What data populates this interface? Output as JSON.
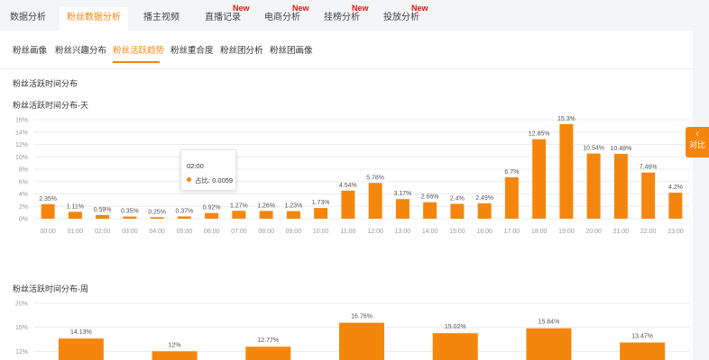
{
  "top_tabs": [
    {
      "label": "数据分析",
      "new": ""
    },
    {
      "label": "粉丝数据分析",
      "new": ""
    },
    {
      "label": "播主视频",
      "new": ""
    },
    {
      "label": "直播记录",
      "new": "New"
    },
    {
      "label": "电商分析",
      "new": "New"
    },
    {
      "label": "挂榜分析",
      "new": "New"
    },
    {
      "label": "投放分析",
      "new": "New"
    }
  ],
  "sub_tabs": [
    "粉丝画像",
    "粉丝兴趣分布",
    "粉丝活跃趋势",
    "粉丝重合度",
    "粉丝团分析",
    "粉丝团画像"
  ],
  "section_title": "粉丝活跃时间分布",
  "compare_button": {
    "chevron": "‹",
    "label": "对比"
  },
  "tooltip": {
    "time": "02:00",
    "label": "占比: 0.0059"
  },
  "colors": {
    "accent": "#f5860d",
    "bar": "#f5860d",
    "grid": "#ececec"
  },
  "chart_data": [
    {
      "type": "bar",
      "title": "粉丝活跃时间分布-天",
      "categories": [
        "00:00",
        "01:00",
        "02:00",
        "03:00",
        "04:00",
        "05:00",
        "06:00",
        "07:00",
        "08:00",
        "09:00",
        "10:00",
        "11:00",
        "12:00",
        "13:00",
        "14:00",
        "15:00",
        "16:00",
        "17:00",
        "18:00",
        "19:00",
        "20:00",
        "21:00",
        "22:00",
        "23:00"
      ],
      "values": [
        2.35,
        1.11,
        0.59,
        0.35,
        0.25,
        0.37,
        0.92,
        1.27,
        1.26,
        1.23,
        1.73,
        4.54,
        5.78,
        3.17,
        2.66,
        2.4,
        2.49,
        6.7,
        12.85,
        15.3,
        10.54,
        10.48,
        7.46,
        4.2
      ],
      "labels": [
        "2.35%",
        "1.11%",
        "0.59%",
        "0.35%",
        "0.25%",
        "0.37%",
        "0.92%",
        "1.27%",
        "1.26%",
        "1.23%",
        "1.73%",
        "4.54%",
        "5.78%",
        "3.17%",
        "2.66%",
        "2.4%",
        "2.49%",
        "6.7%",
        "12.85%",
        "15.3%",
        "10.54%",
        "10.48%",
        "7.46%",
        "4.2%"
      ],
      "yticks": [
        "0%",
        "2%",
        "4%",
        "6%",
        "8%",
        "10%",
        "12%",
        "14%",
        "16%"
      ],
      "ylim": [
        0,
        16
      ],
      "grid": true
    },
    {
      "type": "bar",
      "title": "粉丝活跃时间分布-周",
      "values": [
        14.13,
        12,
        12.77,
        16.76,
        15.02,
        15.84,
        13.47
      ],
      "labels": [
        "14.13%",
        "12%",
        "12.77%",
        "16.76%",
        "15.02%",
        "15.84%",
        "13.47%"
      ],
      "yticks": [
        "12%",
        "16%",
        "20%"
      ],
      "ylim": [
        8,
        20
      ],
      "grid": true
    }
  ]
}
